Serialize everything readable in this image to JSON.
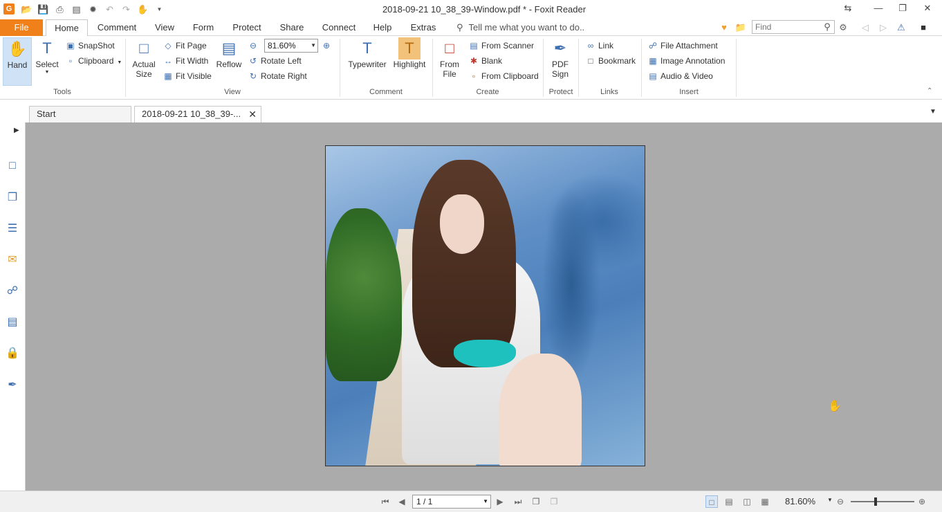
{
  "window": {
    "title": "2018-09-21 10_38_39-Window.pdf * - Foxit Reader",
    "logo": "G"
  },
  "menu": {
    "file": "File",
    "tabs": [
      "Home",
      "Comment",
      "View",
      "Form",
      "Protect",
      "Share",
      "Connect",
      "Help",
      "Extras"
    ],
    "tell_me": "Tell me what you want to do..",
    "find_placeholder": "Find"
  },
  "ribbon": {
    "tools": {
      "hand": "Hand",
      "select": "Select",
      "snapshot": "SnapShot",
      "clipboard": "Clipboard",
      "label": "Tools"
    },
    "view": {
      "actual": "Actual",
      "size": "Size",
      "fit_page": "Fit Page",
      "fit_width": "Fit Width",
      "fit_visible": "Fit Visible",
      "reflow": "Reflow",
      "zoom": "81.60%",
      "rotate_left": "Rotate Left",
      "rotate_right": "Rotate Right",
      "label": "View"
    },
    "comment": {
      "typewriter": "Typewriter",
      "highlight": "Highlight",
      "label": "Comment"
    },
    "create": {
      "from": "From",
      "file": "File",
      "from_scanner": "From Scanner",
      "blank": "Blank",
      "from_clipboard": "From Clipboard",
      "label": "Create"
    },
    "protect": {
      "pdf": "PDF",
      "sign": "Sign",
      "label": "Protect"
    },
    "links": {
      "link": "Link",
      "bookmark": "Bookmark",
      "label": "Links"
    },
    "insert": {
      "file_attachment": "File Attachment",
      "image_annotation": "Image Annotation",
      "audio_video": "Audio & Video",
      "label": "Insert"
    }
  },
  "doc_tabs": [
    {
      "label": "Start"
    },
    {
      "label": "2018-09-21 10_38_39-..."
    }
  ],
  "status": {
    "page": "1 / 1",
    "zoom": "81.60%",
    "zoom_level": 0.39
  },
  "colors": {
    "accent": "#f0801a",
    "viewer_bg": "#ababab",
    "select_bg": "#cfe2f6"
  }
}
